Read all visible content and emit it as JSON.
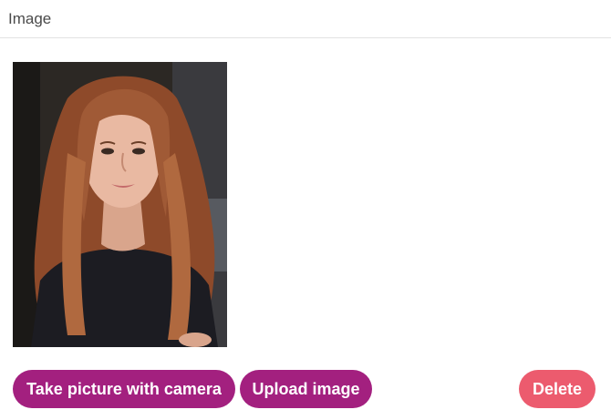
{
  "panel": {
    "title": "Image"
  },
  "photo": {
    "alt": "Portrait photo of a woman with long auburn hair",
    "colors": {
      "background": "#2a2622",
      "hair": "#a05a36",
      "skin": "#e9b9a2",
      "clothing": "#1c1c22"
    }
  },
  "actions": {
    "camera_label": "Take picture with camera",
    "upload_label": "Upload image",
    "delete_label": "Delete"
  },
  "colors": {
    "primary": "#a3207f",
    "danger": "#ec5b6e",
    "title_text": "#4a4a4a",
    "divider": "#e2e2e2"
  }
}
